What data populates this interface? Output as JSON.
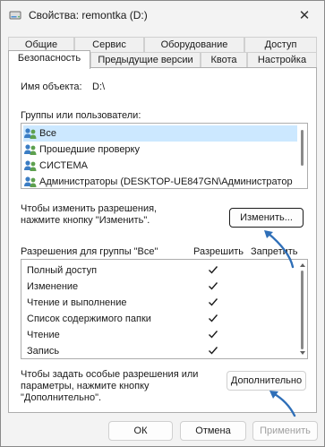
{
  "window": {
    "title": "Свойства: remontka (D:)",
    "close_glyph": "✕"
  },
  "tabs_back": [
    {
      "label": "Общие"
    },
    {
      "label": "Сервис"
    },
    {
      "label": "Оборудование"
    },
    {
      "label": "Доступ"
    }
  ],
  "tabs_front": [
    {
      "label": "Безопасность",
      "active": true
    },
    {
      "label": "Предыдущие версии"
    },
    {
      "label": "Квота"
    },
    {
      "label": "Настройка"
    }
  ],
  "object": {
    "label": "Имя объекта:",
    "value": "D:\\"
  },
  "groups": {
    "label": "Группы или пользователи:",
    "items": [
      {
        "label": "Все",
        "selected": true,
        "icon": "users-icon"
      },
      {
        "label": "Прошедшие проверку",
        "icon": "users-icon"
      },
      {
        "label": "СИСТЕМА",
        "icon": "users-icon"
      },
      {
        "label": "Администраторы (DESKTOP-UE847GN\\Администратор",
        "icon": "users-icon"
      }
    ]
  },
  "change": {
    "hint": "Чтобы изменить разрешения,\nнажмите кнопку \"Изменить\".",
    "button_label": "Изменить..."
  },
  "permissions": {
    "header": "Разрешения для группы \"Все\"",
    "allow_header": "Разрешить",
    "deny_header": "Запретить",
    "rows": [
      {
        "name": "Полный доступ",
        "allow": true,
        "deny": false
      },
      {
        "name": "Изменение",
        "allow": true,
        "deny": false
      },
      {
        "name": "Чтение и выполнение",
        "allow": true,
        "deny": false
      },
      {
        "name": "Список содержимого папки",
        "allow": true,
        "deny": false
      },
      {
        "name": "Чтение",
        "allow": true,
        "deny": false
      },
      {
        "name": "Запись",
        "allow": true,
        "deny": false
      }
    ]
  },
  "advanced": {
    "hint": "Чтобы задать особые разрешения или\nпараметры, нажмите кнопку\n\"Дополнительно\".",
    "button_label": "Дополнительно"
  },
  "footer": {
    "ok_label": "ОК",
    "cancel_label": "Отмена",
    "apply_label": "Применить"
  },
  "colors": {
    "accent_arrow": "#2f6fb8",
    "selection": "#cce8ff"
  }
}
